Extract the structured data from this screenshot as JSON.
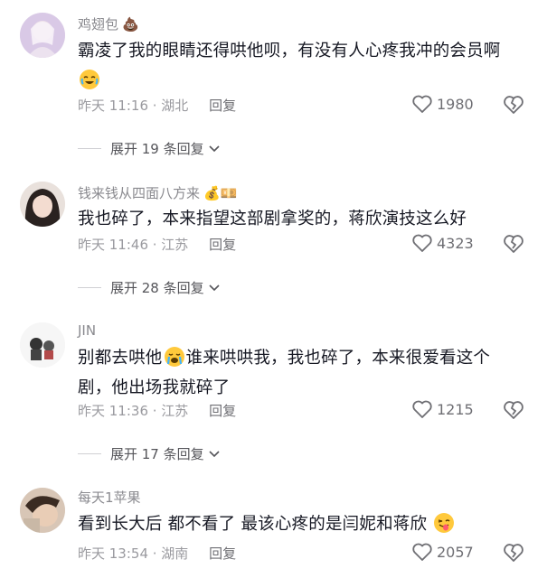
{
  "comments": [
    {
      "username": "鸡翅包",
      "username_emoji": "💩",
      "text": "霸凌了我的眼睛还得哄他呗，有没有人心疼我冲的会员啊",
      "text_emoji": "laugh-cry",
      "time": "昨天 11:16 · 湖北",
      "reply_label": "回复",
      "likes": "1980",
      "expand": "展开 19 条回复"
    },
    {
      "username": "钱来钱从四面八方来",
      "username_emoji": "💰💴",
      "text": "我也碎了，本来指望这部剧拿奖的，蒋欣演技这么好",
      "time": "昨天 11:46 · 江苏",
      "reply_label": "回复",
      "likes": "4323",
      "expand": "展开 28 条回复"
    },
    {
      "username": "JIN",
      "text_part1": "别都去哄他",
      "text_part2": "谁来哄哄我，我也碎了，本来很爱看这个剧，他出场我就碎了",
      "text_emoji": "crying-face",
      "time": "昨天 11:36 · 江苏",
      "reply_label": "回复",
      "likes": "1215",
      "expand": "展开 17 条回复"
    },
    {
      "username": "每天1苹果",
      "text": "看到长大后 都不看了 最该心疼的是闫妮和蒋欣",
      "text_emoji": "tongue-wink-face",
      "time": "昨天 13:54 · 湖南",
      "reply_label": "回复",
      "likes": "2057"
    }
  ],
  "icons": {
    "like": "heart-outline-icon",
    "dislike": "broken-heart-icon",
    "expand": "chevron-down-icon"
  }
}
